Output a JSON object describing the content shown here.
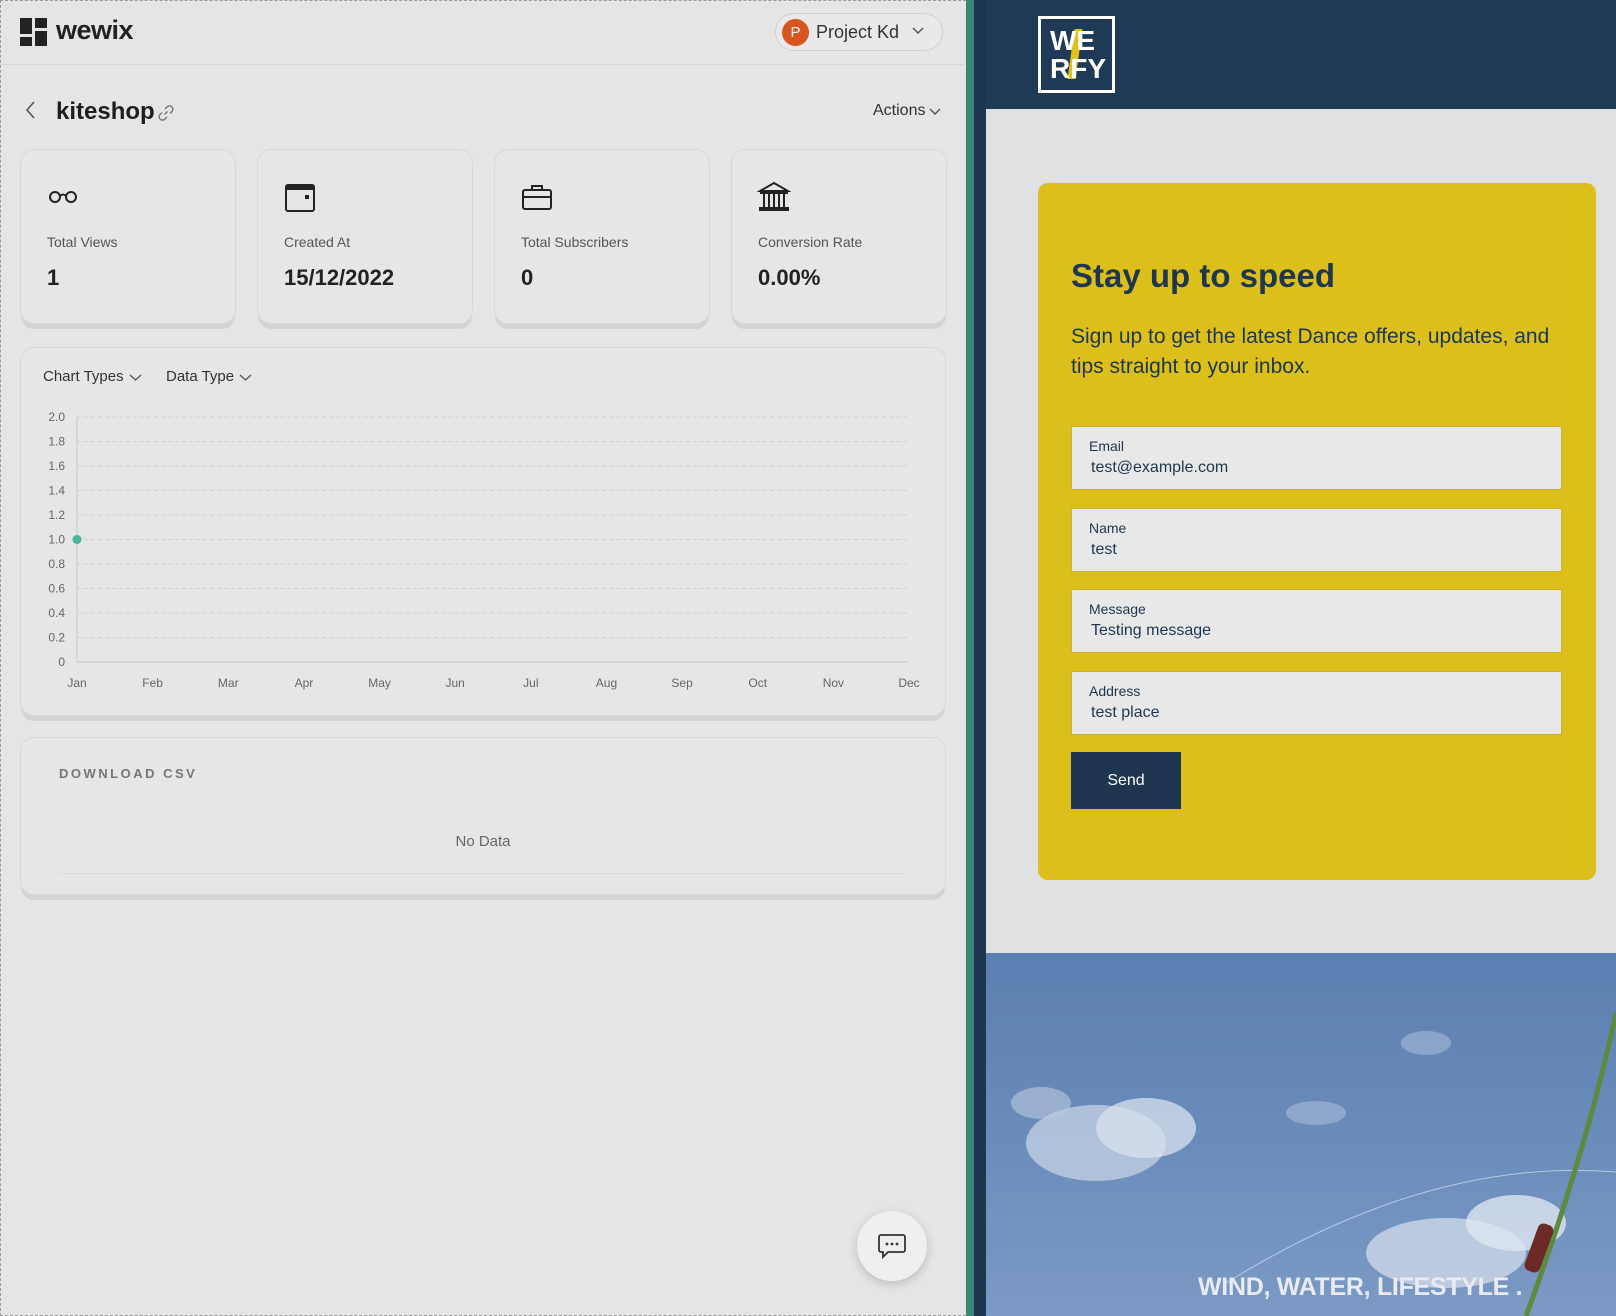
{
  "brand": {
    "name": "wewix"
  },
  "project": {
    "avatar_letter": "P",
    "name": "Project Kd"
  },
  "page": {
    "title": "kiteshop",
    "actions_label": "Actions"
  },
  "stats": [
    {
      "icon": "glasses-icon",
      "label": "Total Views",
      "value": "1"
    },
    {
      "icon": "calendar-icon",
      "label": "Created At",
      "value": "15/12/2022"
    },
    {
      "icon": "briefcase-icon",
      "label": "Total Subscribers",
      "value": "0"
    },
    {
      "icon": "bank-icon",
      "label": "Conversion Rate",
      "value": "0.00%"
    }
  ],
  "chart_controls": {
    "chart_types": "Chart Types",
    "data_type": "Data Type"
  },
  "chart_data": {
    "type": "line",
    "categories": [
      "Jan",
      "Feb",
      "Mar",
      "Apr",
      "May",
      "Jun",
      "Jul",
      "Aug",
      "Sep",
      "Oct",
      "Nov",
      "Dec"
    ],
    "series": [
      {
        "values": [
          1,
          null,
          null,
          null,
          null,
          null,
          null,
          null,
          null,
          null,
          null,
          null
        ],
        "color": "#4bb39a"
      }
    ],
    "yticks": [
      "0",
      "0.2",
      "0.4",
      "0.6",
      "0.8",
      "1.0",
      "1.2",
      "1.4",
      "1.6",
      "1.8",
      "2.0"
    ],
    "ylim": [
      0,
      2
    ],
    "grid": true
  },
  "csv": {
    "title": "DOWNLOAD CSV",
    "empty_text": "No Data"
  },
  "preview": {
    "logo_line1": "WE",
    "logo_line2": "RFY",
    "title": "Stay up to speed",
    "subtitle": "Sign up to get the latest Dance offers, updates, and tips straight to your inbox.",
    "fields": [
      {
        "label": "Email",
        "value": "test@example.com"
      },
      {
        "label": "Name",
        "value": "test"
      },
      {
        "label": "Message",
        "value": "Testing message"
      },
      {
        "label": "Address",
        "value": "test place"
      }
    ],
    "send_label": "Send",
    "hero_caption": "WIND, WATER, LIFESTYLE ."
  }
}
